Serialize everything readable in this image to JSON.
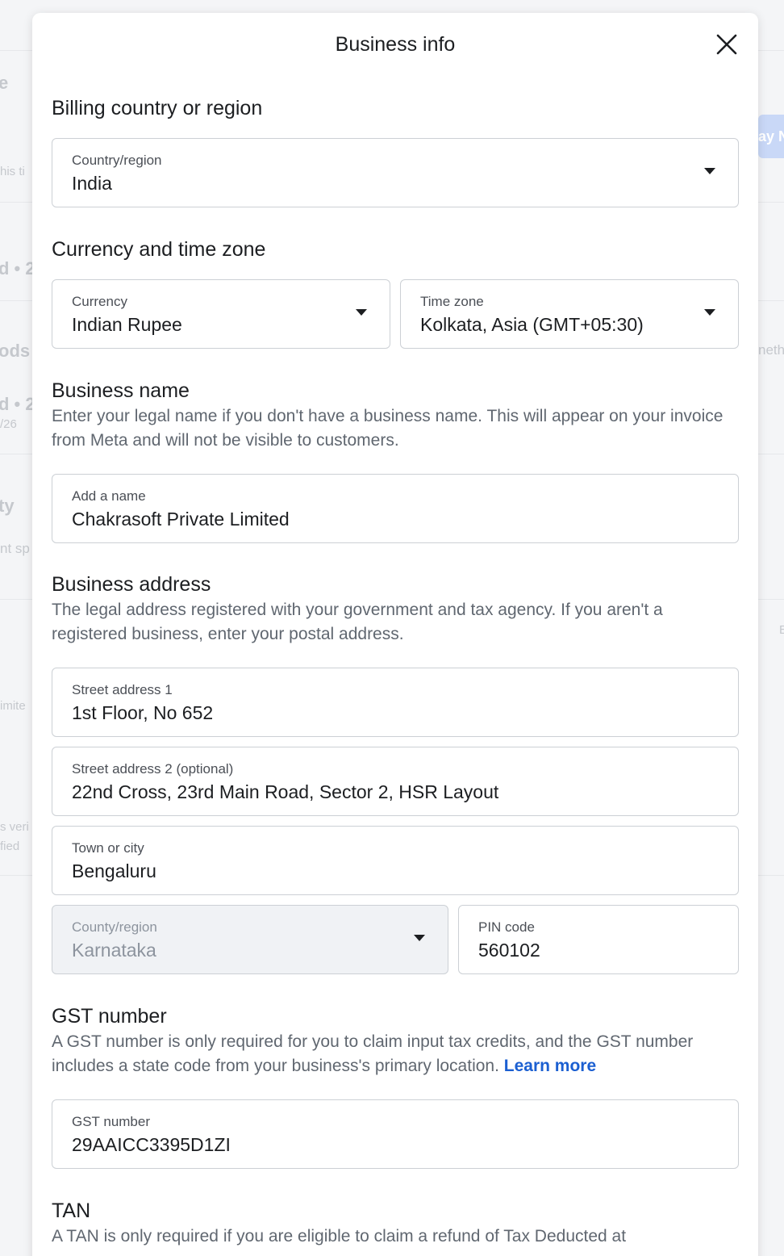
{
  "background": {
    "fragments": [
      "e",
      "his ti",
      "d • 2",
      "ods",
      "d • 2",
      "/26",
      "ty",
      "nt sp",
      "imite",
      "s veri",
      "fied",
      "ay N",
      "neth",
      "E"
    ]
  },
  "modal": {
    "title": "Business info",
    "billing": {
      "title": "Billing country or region",
      "country_label": "Country/region",
      "country_value": "India"
    },
    "currency_tz": {
      "title": "Currency and time zone",
      "currency_label": "Currency",
      "currency_value": "Indian Rupee",
      "tz_label": "Time zone",
      "tz_value": "Kolkata, Asia (GMT+05:30)"
    },
    "business_name": {
      "title": "Business name",
      "desc": "Enter your legal name if you don't have a business name. This will appear on your invoice from Meta and will not be visible to customers.",
      "label": "Add a name",
      "value": "Chakrasoft Private Limited"
    },
    "address": {
      "title": "Business address",
      "desc": "The legal address registered with your government and tax agency. If you aren't a registered business, enter your postal address.",
      "street1_label": "Street address 1",
      "street1_value": "1st Floor, No 652",
      "street2_label": "Street address 2 (optional)",
      "street2_value": "22nd Cross, 23rd Main Road, Sector 2, HSR Layout",
      "city_label": "Town or city",
      "city_value": "Bengaluru",
      "county_label": "County/region",
      "county_value": "Karnataka",
      "pin_label": "PIN code",
      "pin_value": "560102"
    },
    "gst": {
      "title": "GST number",
      "desc": "A GST number is only required for you to claim input tax credits, and the GST number includes a state code from your business's primary location.",
      "learn_more": "Learn more",
      "label": "GST number",
      "value": "29AAICC3395D1ZI"
    },
    "tan": {
      "title": "TAN",
      "desc": "A TAN is only required if you are eligible to claim a refund of Tax Deducted at"
    }
  }
}
